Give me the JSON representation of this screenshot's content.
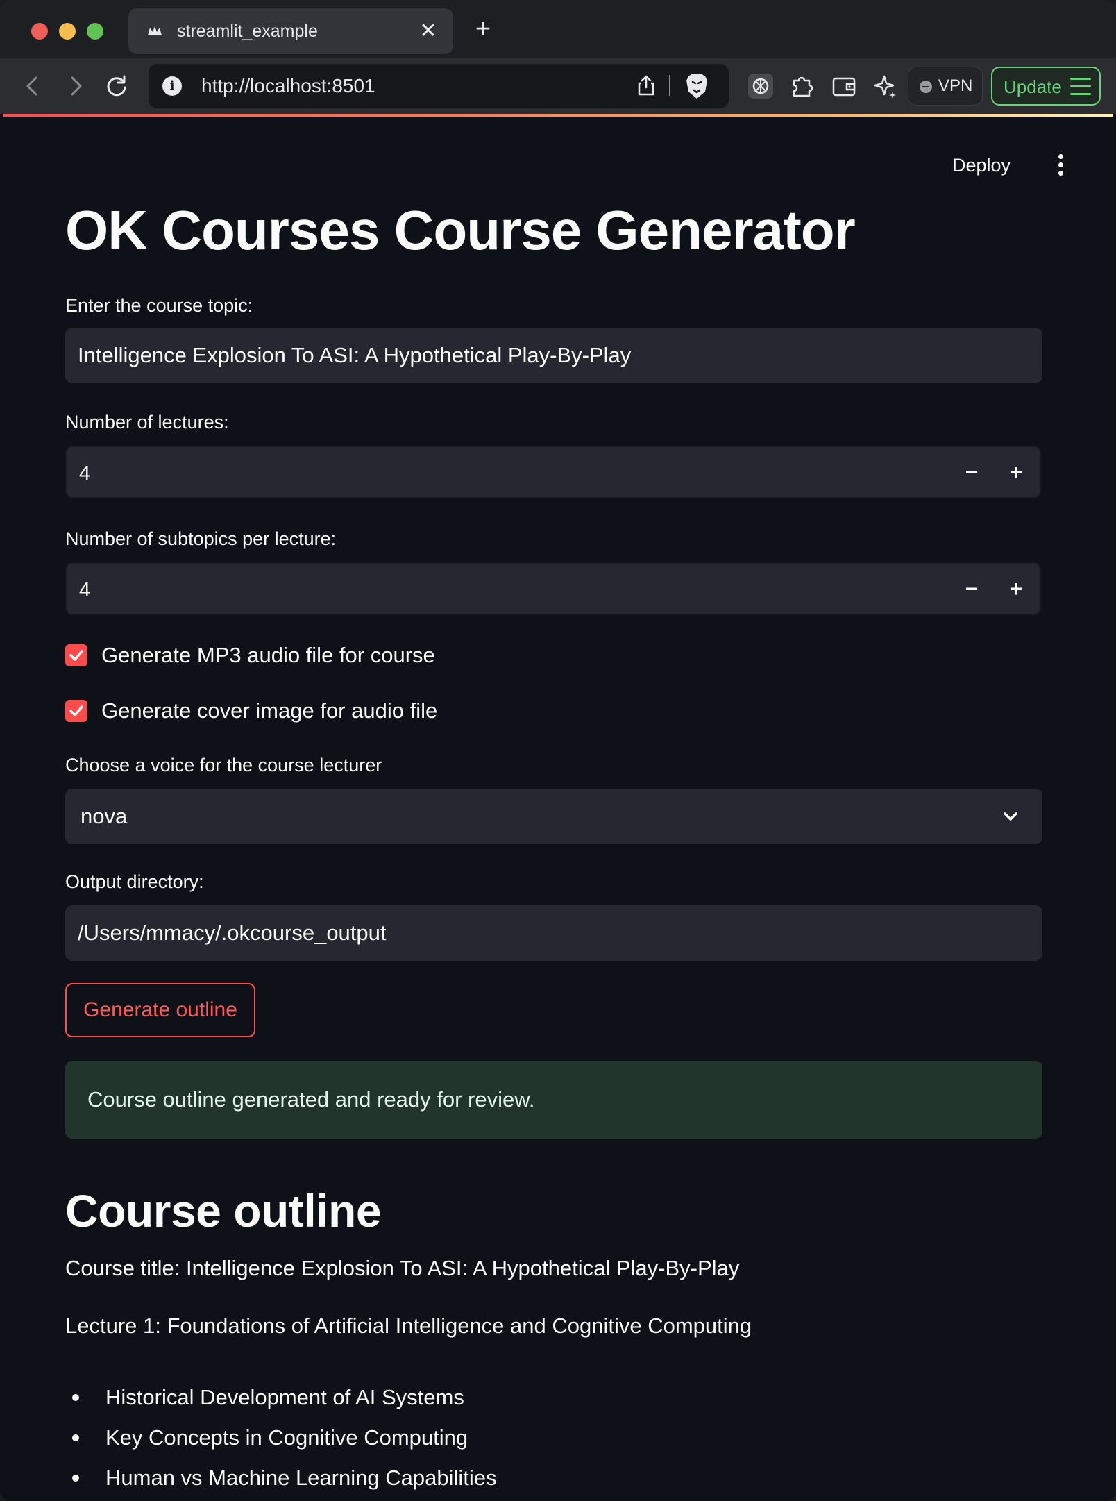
{
  "browser": {
    "tab_title": "streamlit_example",
    "tab_close": "✕",
    "new_tab": "+",
    "url": "http://localhost:8501",
    "vpn_label": "VPN",
    "update_label": "Update"
  },
  "app": {
    "deploy_label": "Deploy",
    "title": "OK Courses Course Generator",
    "topic": {
      "label": "Enter the course topic:",
      "value": "Intelligence Explosion To ASI: A Hypothetical Play-By-Play"
    },
    "lectures": {
      "label": "Number of lectures:",
      "value": "4",
      "minus": "−",
      "plus": "+"
    },
    "subtopics": {
      "label": "Number of subtopics per lecture:",
      "value": "4",
      "minus": "−",
      "plus": "+"
    },
    "checkboxes": [
      {
        "label": "Generate MP3 audio file for course",
        "checked": true
      },
      {
        "label": "Generate cover image for audio file",
        "checked": true
      }
    ],
    "voice": {
      "label": "Choose a voice for the course lecturer",
      "value": "nova"
    },
    "output_dir": {
      "label": "Output directory:",
      "value": "/Users/mmacy/.okcourse_output"
    },
    "generate_button": "Generate outline",
    "success_message": "Course outline generated and ready for review.",
    "outline": {
      "heading": "Course outline",
      "course_title": "Course title: Intelligence Explosion To ASI: A Hypothetical Play-By-Play",
      "lecture_1": "Lecture 1: Foundations of Artificial Intelligence and Cognitive Computing",
      "lecture_1_items": [
        "Historical Development of AI Systems",
        "Key Concepts in Cognitive Computing",
        "Human vs Machine Learning Capabilities"
      ]
    }
  },
  "colors": {
    "accent": "#ff4b4b",
    "background": "#0e1117",
    "input_bg": "#262730",
    "success_bg": "#21352a",
    "update_green": "#6ad07a"
  },
  "icons": {
    "back": "chevron-left-icon",
    "forward": "chevron-right-icon",
    "reload": "reload-icon",
    "site_info": "info-icon",
    "share": "share-icon",
    "brave_shield": "lion-shield-icon",
    "chatgpt": "chatgpt-icon",
    "extensions": "puzzle-icon",
    "wallet": "wallet-icon",
    "leo": "sparkle-icon",
    "menu": "hamburger-icon",
    "app_menu": "kebab-icon",
    "select": "chevron-down-icon",
    "check": "checkmark-icon"
  }
}
